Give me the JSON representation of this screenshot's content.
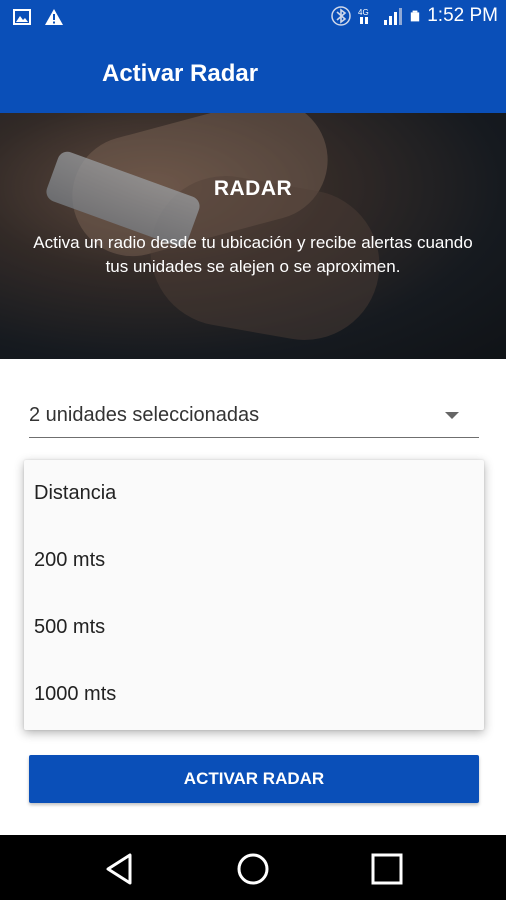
{
  "status_bar": {
    "time": "1:52 PM",
    "network_label": "4G",
    "icons": [
      "image-icon",
      "warning-icon",
      "bluetooth-icon",
      "network-icon",
      "signal-icon",
      "battery-icon"
    ]
  },
  "app_bar": {
    "title": "Activar Radar"
  },
  "hero": {
    "title": "RADAR",
    "description": "Activa un radio desde tu ubicación y recibe alertas cuando tus unidades se alejen o se aproximen."
  },
  "unit_select": {
    "value": "2 unidades seleccionadas"
  },
  "distance_dropdown": {
    "items": [
      "Distancia",
      "200 mts",
      "500 mts",
      "1000 mts"
    ]
  },
  "actions": {
    "activate_label": "ACTIVAR RADAR"
  },
  "navigation": {
    "icons": [
      "back-icon",
      "home-icon",
      "recents-icon"
    ]
  },
  "colors": {
    "primary": "#0a4fb8",
    "nav_bar": "#000000"
  }
}
